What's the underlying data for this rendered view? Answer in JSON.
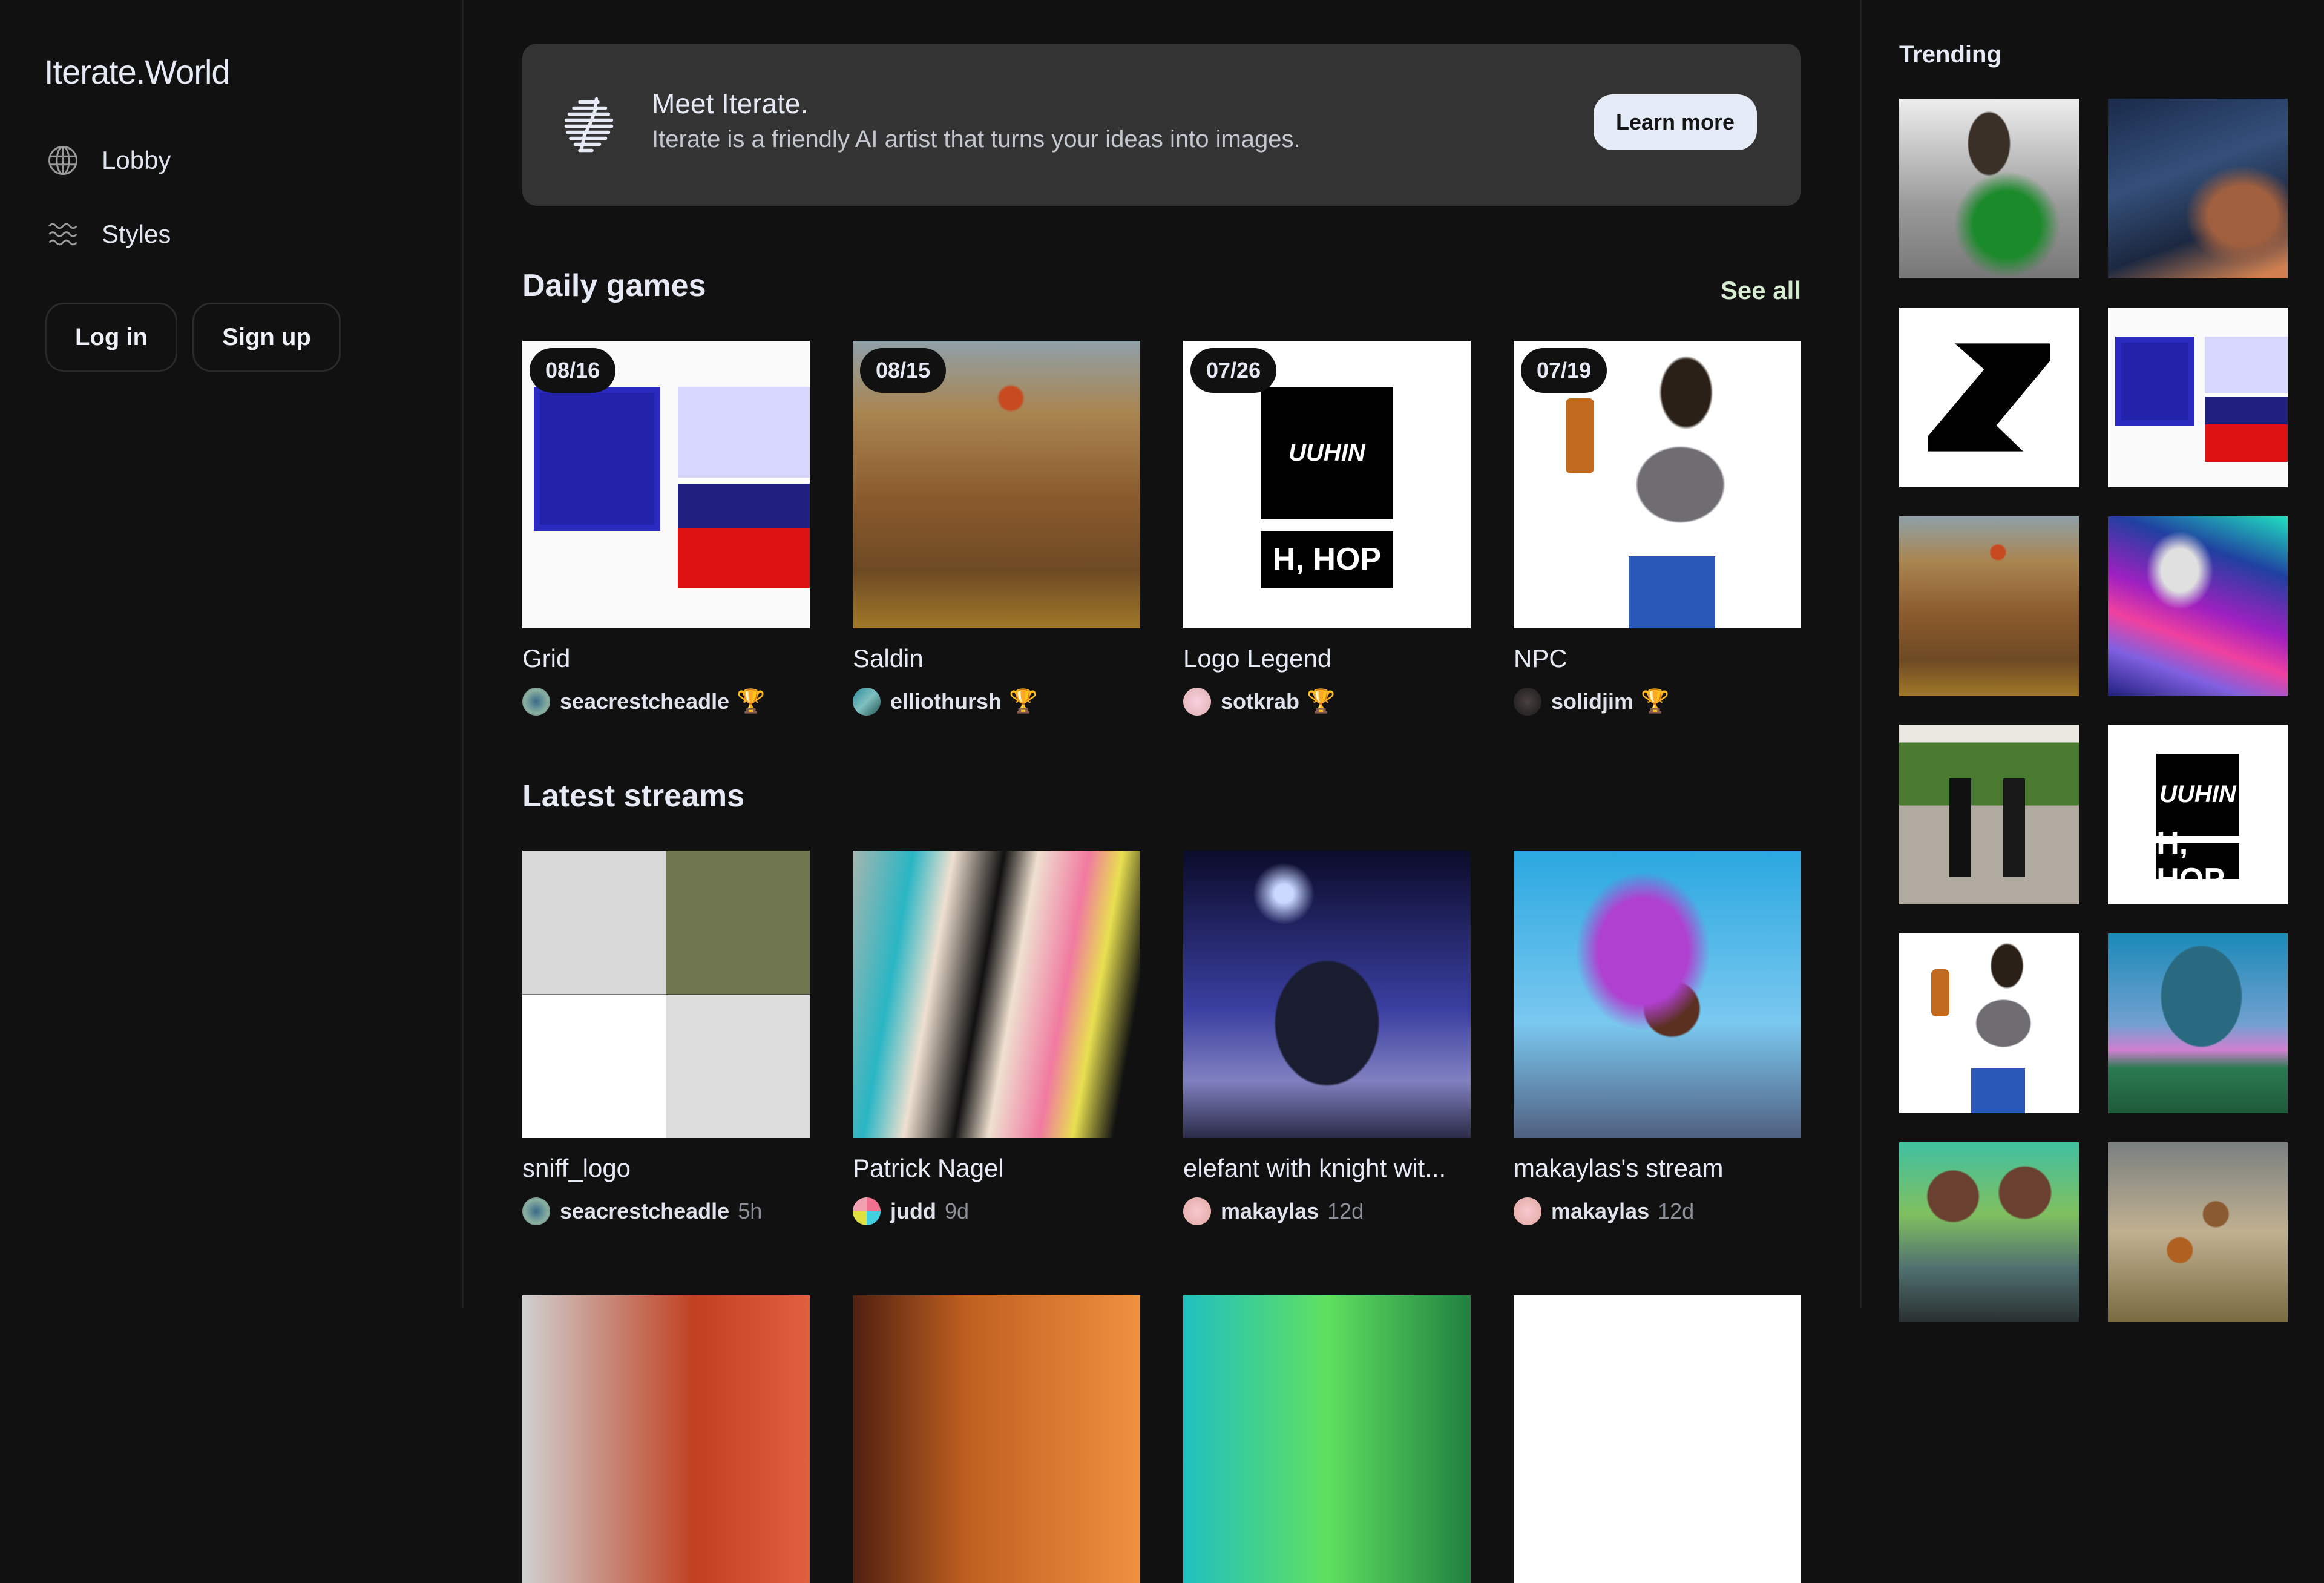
{
  "app": {
    "brand": "Iterate.World"
  },
  "sidebar": {
    "items": [
      {
        "label": "Lobby",
        "icon": "globe-icon"
      },
      {
        "label": "Styles",
        "icon": "waves-icon"
      }
    ],
    "login_label": "Log in",
    "signup_label": "Sign up"
  },
  "banner": {
    "title": "Meet Iterate.",
    "subtitle": "Iterate is a friendly AI artist that turns your ideas into images.",
    "button_label": "Learn more",
    "icon": "iterate-logo-icon"
  },
  "daily_games": {
    "heading": "Daily games",
    "see_all_label": "See all",
    "cards": [
      {
        "date": "08/16",
        "title": "Grid",
        "user": "seacrestcheadle",
        "trophy": "🏆",
        "image": "grid"
      },
      {
        "date": "08/15",
        "title": "Saldin",
        "user": "elliothursh",
        "trophy": "🏆",
        "image": "battle"
      },
      {
        "date": "07/26",
        "title": "Logo Legend",
        "user": "sotkrab",
        "trophy": "🏆",
        "image": "logo"
      },
      {
        "date": "07/19",
        "title": "NPC",
        "user": "solidjim",
        "trophy": "🏆",
        "image": "npc"
      }
    ]
  },
  "latest_streams": {
    "heading": "Latest streams",
    "cards": [
      {
        "title": "sniff_logo",
        "user": "seacrestcheadle",
        "age": "5h",
        "image": "sniff"
      },
      {
        "title": "Patrick Nagel",
        "user": "judd",
        "age": "9d",
        "image": "nagel"
      },
      {
        "title": "elefant with knight wit...",
        "user": "makaylas",
        "age": "12d",
        "image": "elefant"
      },
      {
        "title": "makaylas's stream",
        "user": "makaylas",
        "age": "12d",
        "image": "pegasus"
      }
    ]
  },
  "trending": {
    "heading": "Trending",
    "tiles": [
      {
        "image": "green-lantern-portrait"
      },
      {
        "image": "wolf-night-sky"
      },
      {
        "image": "z-logo"
      },
      {
        "image": "grid-poster"
      },
      {
        "image": "battle-scene"
      },
      {
        "image": "cosmic-landscape"
      },
      {
        "image": "segway-riders"
      },
      {
        "image": "hhop-logo"
      },
      {
        "image": "anime-npc"
      },
      {
        "image": "surreal-tree"
      },
      {
        "image": "twin-portrait"
      },
      {
        "image": "flying-chickens"
      }
    ]
  },
  "colors": {
    "background": "#111111",
    "banner": "#333333",
    "accent_link": "#d6ecd0",
    "button_light": "#e6ebf8",
    "trophy": "#d9a21b"
  }
}
